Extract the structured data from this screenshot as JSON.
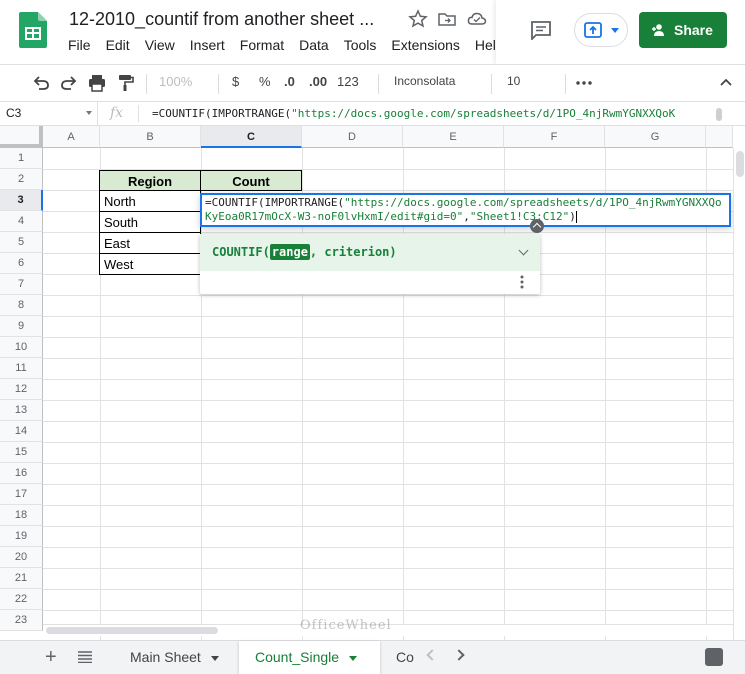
{
  "doc": {
    "title": "12-2010_countif from another sheet ..."
  },
  "menu": [
    "File",
    "Edit",
    "View",
    "Insert",
    "Format",
    "Data",
    "Tools",
    "Extensions",
    "Hel"
  ],
  "share": {
    "label": "Share"
  },
  "toolbar": {
    "zoom": "100%",
    "currency": "$",
    "percent": "%",
    "dec_decrease": ".0",
    "dec_increase": ".00",
    "more_formats": "123",
    "font": "Inconsolata",
    "font_size": "10"
  },
  "formula_bar": {
    "name_box": "C3",
    "fx": "fx",
    "formula_prefix": "=COUNTIF(IMPORTRANGE(",
    "formula_string": "\"https://docs.google.com/spreadsheets/d/1PO_4njRwmYGNXXQoK"
  },
  "columns": [
    "A",
    "B",
    "C",
    "D",
    "E",
    "F",
    "G"
  ],
  "rows": [
    "1",
    "2",
    "3",
    "4",
    "5",
    "6",
    "7",
    "8",
    "9",
    "10",
    "11",
    "12",
    "13",
    "14",
    "15",
    "16",
    "17",
    "18",
    "19",
    "20",
    "21",
    "22",
    "23"
  ],
  "table": {
    "headers": [
      "Region",
      "Count"
    ],
    "regions": [
      "North",
      "South",
      "East",
      "West"
    ]
  },
  "editor": {
    "prefix": "=COUNTIF(IMPORTRANGE(",
    "url": "\"https://docs.google.com/spreadsheets/d/1PO_4njRwmYGNXXQoKyEoa0R17mOcX-W3-noF0lvHxmI/edit#gid=0\"",
    "comma": ",",
    "range": "\"Sheet1!C3:C12\"",
    "suffix": ")"
  },
  "helper": {
    "fn": "COUNTIF(",
    "arg1": "range",
    "rest": ", criterion)"
  },
  "sheets": {
    "tab1": "Main Sheet",
    "tab2": "Count_Single",
    "tab3": "Co"
  },
  "watermark": "OfficeWheel",
  "colors": {
    "brand_green": "#188038",
    "header_fill": "#d9ead3",
    "selection_blue": "#1a73e8"
  }
}
